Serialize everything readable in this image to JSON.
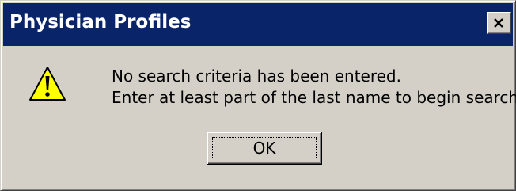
{
  "window": {
    "title": "Physician Profiles",
    "close_icon": "close-icon",
    "titlebar_color": "#0a246a"
  },
  "dialog": {
    "icon": "warning-icon",
    "message_line1": "No search criteria has been entered.",
    "message_line2": "Enter at least part of the last name to begin search.",
    "ok_label": "OK"
  }
}
